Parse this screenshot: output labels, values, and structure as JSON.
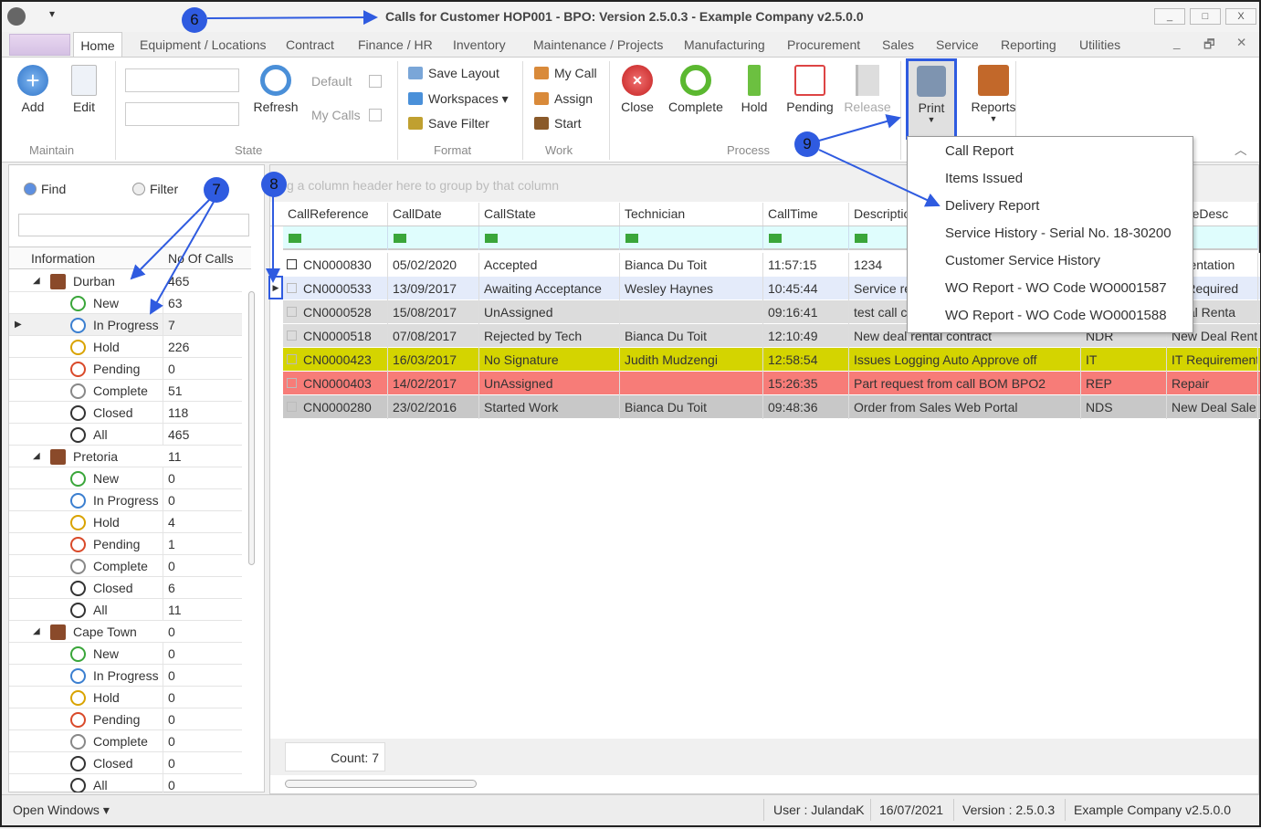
{
  "window": {
    "title": "Calls for Customer HOP001 - BPO: Version 2.5.0.3 - Example Company v2.5.0.0",
    "minimize": "_",
    "maximize": "□",
    "close": "X"
  },
  "tabs": [
    "Home",
    "Equipment / Locations",
    "Contract",
    "Finance / HR",
    "Inventory",
    "Maintenance / Projects",
    "Manufacturing",
    "Procurement",
    "Sales",
    "Service",
    "Reporting",
    "Utilities"
  ],
  "ribbon": {
    "maintain": {
      "label": "Maintain",
      "add": "Add",
      "edit": "Edit"
    },
    "state": {
      "label": "State",
      "refresh": "Refresh",
      "default": "Default",
      "my_calls": "My Calls"
    },
    "format": {
      "label": "Format",
      "save_layout": "Save Layout",
      "workspaces": "Workspaces ▾",
      "save_filter": "Save Filter"
    },
    "work": {
      "label": "Work",
      "my_call": "My Call",
      "assign": "Assign",
      "start": "Start"
    },
    "process": {
      "label": "Process",
      "close": "Close",
      "complete": "Complete",
      "hold": "Hold",
      "pending": "Pending",
      "release": "Release"
    },
    "print": "Print",
    "reports": "Reports"
  },
  "print_menu": [
    "Call Report",
    "Items Issued",
    "Delivery Report",
    "Service History - Serial No. 18-30200",
    "Customer Service History",
    "WO Report - WO Code WO0001587",
    "WO Report - WO Code WO0001588"
  ],
  "left_panel": {
    "find": "Find",
    "filter": "Filter",
    "search_value": "",
    "headers": [
      "Information",
      "No Of Calls"
    ],
    "branches": [
      {
        "name": "Durban",
        "count": "465",
        "states": [
          [
            "New",
            "63"
          ],
          [
            "In Progress",
            "7"
          ],
          [
            "Hold",
            "226"
          ],
          [
            "Pending",
            "0"
          ],
          [
            "Complete",
            "51"
          ],
          [
            "Closed",
            "118"
          ],
          [
            "All",
            "465"
          ]
        ]
      },
      {
        "name": "Pretoria",
        "count": "11",
        "states": [
          [
            "New",
            "0"
          ],
          [
            "In Progress",
            "0"
          ],
          [
            "Hold",
            "4"
          ],
          [
            "Pending",
            "1"
          ],
          [
            "Complete",
            "0"
          ],
          [
            "Closed",
            "6"
          ],
          [
            "All",
            "11"
          ]
        ]
      },
      {
        "name": "Cape Town",
        "count": "0",
        "states": [
          [
            "New",
            "0"
          ],
          [
            "In Progress",
            "0"
          ],
          [
            "Hold",
            "0"
          ],
          [
            "Pending",
            "0"
          ],
          [
            "Complete",
            "0"
          ],
          [
            "Closed",
            "0"
          ],
          [
            "All",
            "0"
          ]
        ]
      }
    ],
    "selected": "Durban / In Progress"
  },
  "grid": {
    "group_hint": "g a column header here to group by that column",
    "columns": [
      "CallReference",
      "CallDate",
      "CallState",
      "Technician",
      "CallTime",
      "Descriptio",
      "",
      "TypeDesc"
    ],
    "rows": [
      {
        "color": "#ffffff",
        "cells": [
          "CN0000830",
          "05/02/2020",
          "Accepted",
          "Bianca Du Toit",
          "11:57:15",
          "1234",
          "",
          "ementation"
        ]
      },
      {
        "color": "#e4ebfa",
        "cells": [
          "CN0000533",
          "13/09/2017",
          "Awaiting Acceptance",
          "Wesley Haynes",
          "10:45:44",
          "Service re",
          "",
          "er Required"
        ]
      },
      {
        "color": "#dcdcdc",
        "cells": [
          "CN0000528",
          "15/08/2017",
          "UnAssigned",
          "",
          "09:16:41",
          "test call c",
          "",
          "Deal Renta"
        ]
      },
      {
        "color": "#dcdcdc",
        "cells": [
          "CN0000518",
          "07/08/2017",
          "Rejected by Tech",
          "Bianca Du Toit",
          "12:10:49",
          "New deal rental contract",
          "NDR",
          "New Deal Renta"
        ]
      },
      {
        "color": "#d4d400",
        "cells": [
          "CN0000423",
          "16/03/2017",
          "No Signature",
          "Judith Mudzengi",
          "12:58:54",
          "Issues Logging Auto Approve off",
          "IT",
          "IT Requirement"
        ]
      },
      {
        "color": "#f77c78",
        "cells": [
          "CN0000403",
          "14/02/2017",
          "UnAssigned",
          "",
          "15:26:35",
          "Part request from call BOM BPO2",
          "REP",
          "Repair"
        ]
      },
      {
        "color": "#c8c8c8",
        "cells": [
          "CN0000280",
          "23/02/2016",
          "Started Work",
          "Bianca Du Toit",
          "09:48:36",
          "Order from Sales Web Portal",
          "NDS",
          "New Deal Sale"
        ]
      }
    ],
    "count": "Count: 7"
  },
  "status": {
    "open_windows": "Open Windows ▾",
    "user": "User : JulandaK",
    "date": "16/07/2021",
    "version": "Version : 2.5.0.3",
    "company": "Example Company v2.5.0.0"
  },
  "annotations": [
    "6",
    "7",
    "8",
    "9"
  ],
  "colors": {
    "annotation": "#2f5be0",
    "state_new": "#3aa63a",
    "state_progress": "#3b7fd0",
    "state_hold": "#d9a300",
    "state_pending": "#d94a2a"
  }
}
